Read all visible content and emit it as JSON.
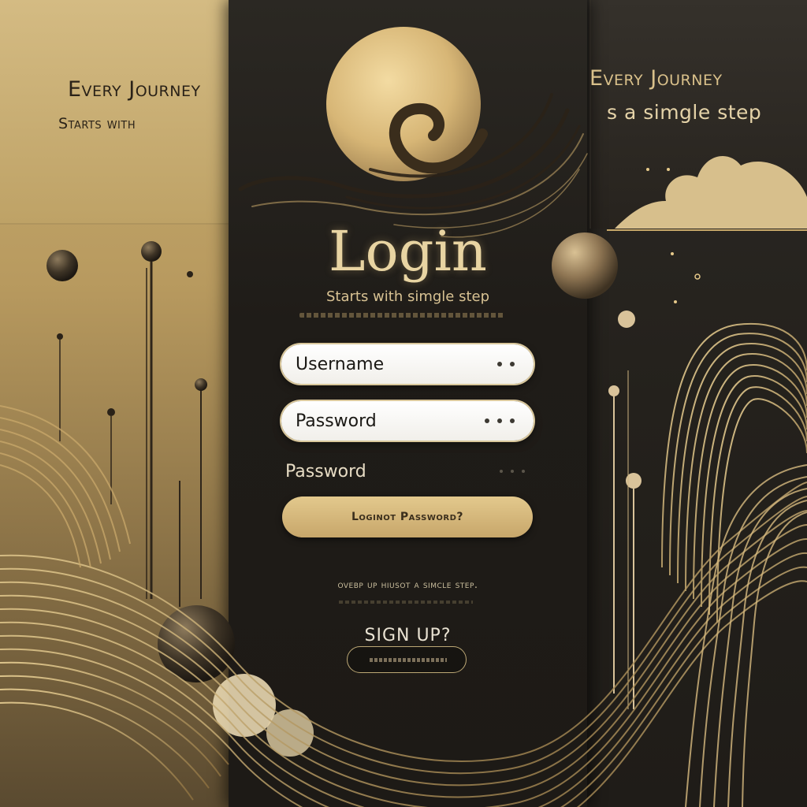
{
  "left_panel": {
    "quote_line1": "Every Journey",
    "quote_line2": "Starts with"
  },
  "right_panel": {
    "quote_line1": "Every Journey",
    "quote_line2": "s a simgle step"
  },
  "login": {
    "title": "Login",
    "subtitle": "Starts with simgle step",
    "username_label": "Username",
    "password_label": "Password",
    "password_label_2": "Password",
    "login_button_label": "Loginot Password?",
    "tagline": "ovebp up hiusot a simcle step.",
    "signup_label": "SIGN UP?"
  },
  "colors": {
    "gold": "#d8bf86",
    "dark": "#1f1c18",
    "button": "#d3b478"
  }
}
